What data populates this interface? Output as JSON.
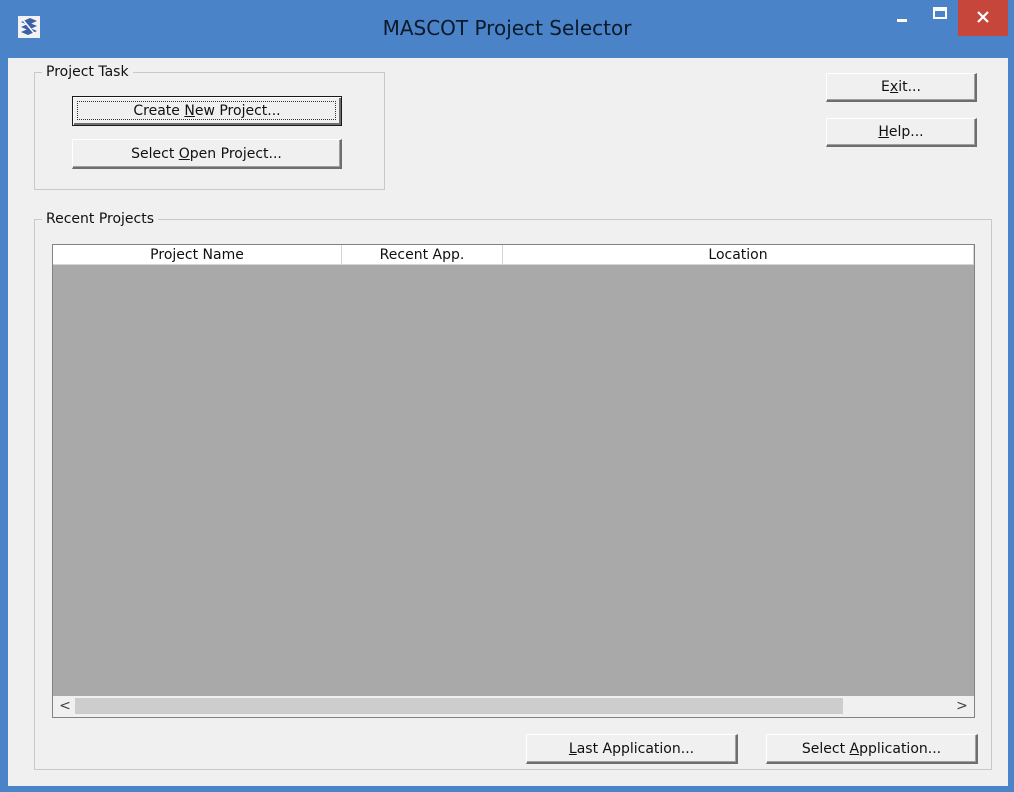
{
  "window": {
    "title": "MASCOT Project Selector",
    "controls": {
      "minimize": "–",
      "maximize": "□",
      "close": "✕"
    },
    "icon": "mascot-app-icon"
  },
  "project_task": {
    "label": "Project Task",
    "create_new": {
      "pre": "Create ",
      "accel": "N",
      "post": "ew Project..."
    },
    "select_open": {
      "pre": "Select ",
      "accel": "O",
      "post": "pen Project..."
    }
  },
  "side_buttons": {
    "exit": {
      "pre": "E",
      "accel": "x",
      "post": "it..."
    },
    "help": {
      "pre": "",
      "accel": "H",
      "post": "elp..."
    }
  },
  "recent_projects": {
    "label": "Recent Projects",
    "columns": [
      "Project Name",
      "Recent App.",
      "Location"
    ],
    "rows": []
  },
  "scrollbar": {
    "left_arrow": "<",
    "right_arrow": ">"
  },
  "bottom_buttons": {
    "last_application": {
      "pre": "",
      "accel": "L",
      "post": "ast Application..."
    },
    "select_application": {
      "pre": "Select ",
      "accel": "A",
      "post": "pplication..."
    }
  },
  "colors": {
    "titlebar": "#4a83c7",
    "close_button": "#c7463c",
    "client": "#f0f0f0",
    "list_background": "#a9a9a9"
  }
}
